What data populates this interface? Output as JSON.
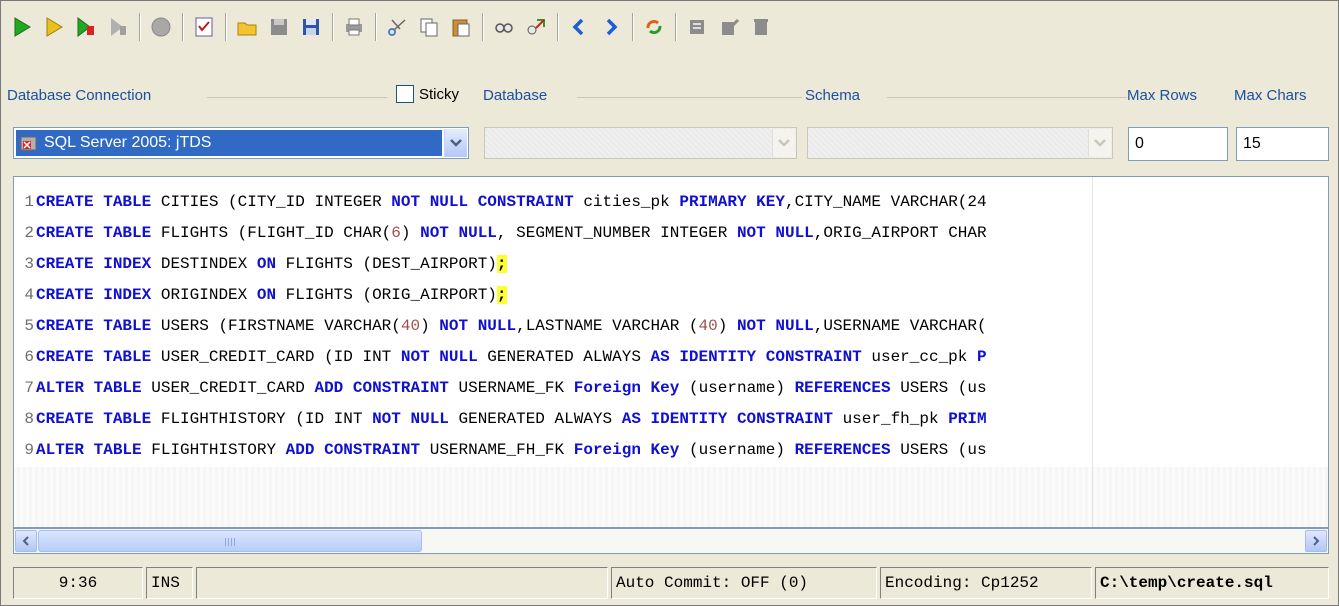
{
  "toolbar": {
    "buttons": [
      {
        "name": "execute-icon",
        "color": "#22a822"
      },
      {
        "name": "execute-current-icon",
        "color": "#d0a000"
      },
      {
        "name": "execute-all-icon",
        "color": "#22a822"
      },
      {
        "name": "stop-all-icon",
        "color": "#9c9c9c"
      },
      {
        "name": "stop-icon",
        "color": "#9c9c9c"
      },
      {
        "name": "commit-icon",
        "color": "#7c4fa8"
      },
      {
        "name": "open-folder-icon",
        "color": "#e8b018"
      },
      {
        "name": "save-disabled-icon",
        "color": "#8c8c8c"
      },
      {
        "name": "save-as-icon",
        "color": "#2f55a8"
      },
      {
        "name": "print-icon",
        "color": "#6c6c6c"
      },
      {
        "name": "cut-icon",
        "color": "#4f7fd0"
      },
      {
        "name": "copy-icon",
        "color": "#6c6c6c"
      },
      {
        "name": "paste-icon",
        "color": "#c89038"
      },
      {
        "name": "find-icon",
        "color": "#6c6c6c"
      },
      {
        "name": "replace-icon",
        "color": "#3a9a3a"
      },
      {
        "name": "previous-icon",
        "color": "#1c5ed8"
      },
      {
        "name": "next-icon",
        "color": "#1c5ed8"
      },
      {
        "name": "refresh-icon",
        "color": "#e06010"
      },
      {
        "name": "history-icon",
        "color": "#8c8c8c"
      },
      {
        "name": "edit-disabled-icon",
        "color": "#8c8c8c"
      },
      {
        "name": "delete-disabled-icon",
        "color": "#8c8c8c"
      }
    ]
  },
  "connection": {
    "db_connection_label": "Database Connection",
    "sticky_label": "Sticky",
    "database_label": "Database",
    "schema_label": "Schema",
    "max_rows_label": "Max Rows",
    "max_chars_label": "Max Chars",
    "db_connection_value": "SQL Server 2005: jTDS",
    "max_rows_value": "0",
    "max_chars_value": "15"
  },
  "editor": {
    "lines": [
      {
        "n": "1",
        "tokens": [
          [
            "kw",
            "CREATE"
          ],
          [
            "t",
            " "
          ],
          [
            "kw",
            "TABLE"
          ],
          [
            "t",
            " CITIES (CITY_ID INTEGER "
          ],
          [
            "kw",
            "NOT NULL"
          ],
          [
            "t",
            " "
          ],
          [
            "kw",
            "CONSTRAINT"
          ],
          [
            "t",
            " cities_pk "
          ],
          [
            "kw",
            "PRIMARY KEY"
          ],
          [
            "t",
            ",CITY_NAME VARCHAR(24"
          ]
        ]
      },
      {
        "n": "2",
        "tokens": [
          [
            "kw",
            "CREATE"
          ],
          [
            "t",
            " "
          ],
          [
            "kw",
            "TABLE"
          ],
          [
            "t",
            " FLIGHTS (FLIGHT_ID CHAR("
          ],
          [
            "num",
            "6"
          ],
          [
            "t",
            ") "
          ],
          [
            "kw",
            "NOT NULL"
          ],
          [
            "t",
            ", SEGMENT_NUMBER INTEGER "
          ],
          [
            "kw",
            "NOT NULL"
          ],
          [
            "t",
            ",ORIG_AIRPORT CHAR"
          ]
        ]
      },
      {
        "n": "3",
        "tokens": [
          [
            "kw",
            "CREATE"
          ],
          [
            "t",
            " "
          ],
          [
            "kw",
            "INDEX"
          ],
          [
            "t",
            " DESTINDEX "
          ],
          [
            "kw",
            "ON"
          ],
          [
            "t",
            " FLIGHTS (DEST_AIRPORT)"
          ],
          [
            "hl",
            ";"
          ]
        ]
      },
      {
        "n": "4",
        "tokens": [
          [
            "kw",
            "CREATE"
          ],
          [
            "t",
            " "
          ],
          [
            "kw",
            "INDEX"
          ],
          [
            "t",
            " ORIGINDEX "
          ],
          [
            "kw",
            "ON"
          ],
          [
            "t",
            " FLIGHTS (ORIG_AIRPORT)"
          ],
          [
            "hl",
            ";"
          ]
        ]
      },
      {
        "n": "5",
        "tokens": [
          [
            "kw",
            "CREATE"
          ],
          [
            "t",
            " "
          ],
          [
            "kw",
            "TABLE"
          ],
          [
            "t",
            " USERS (FIRSTNAME VARCHAR("
          ],
          [
            "num",
            "40"
          ],
          [
            "t",
            ") "
          ],
          [
            "kw",
            "NOT NULL"
          ],
          [
            "t",
            ",LASTNAME VARCHAR ("
          ],
          [
            "num",
            "40"
          ],
          [
            "t",
            ") "
          ],
          [
            "kw",
            "NOT NULL"
          ],
          [
            "t",
            ",USERNAME VARCHAR("
          ]
        ]
      },
      {
        "n": "6",
        "tokens": [
          [
            "kw",
            "CREATE"
          ],
          [
            "t",
            " "
          ],
          [
            "kw",
            "TABLE"
          ],
          [
            "t",
            " USER_CREDIT_CARD (ID INT "
          ],
          [
            "kw",
            "NOT NULL"
          ],
          [
            "t",
            " GENERATED ALWAYS "
          ],
          [
            "kw",
            "AS"
          ],
          [
            "t",
            " "
          ],
          [
            "kw",
            "IDENTITY"
          ],
          [
            "t",
            " "
          ],
          [
            "kw",
            "CONSTRAINT"
          ],
          [
            "t",
            " user_cc_pk "
          ],
          [
            "kw",
            "P"
          ]
        ]
      },
      {
        "n": "7",
        "tokens": [
          [
            "kw",
            "ALTER"
          ],
          [
            "t",
            " "
          ],
          [
            "kw",
            "TABLE"
          ],
          [
            "t",
            " USER_CREDIT_CARD "
          ],
          [
            "kw",
            "ADD"
          ],
          [
            "t",
            " "
          ],
          [
            "kw",
            "CONSTRAINT"
          ],
          [
            "t",
            " USERNAME_FK "
          ],
          [
            "kw",
            "Foreign Key"
          ],
          [
            "t",
            " (username) "
          ],
          [
            "kw",
            "REFERENCES"
          ],
          [
            "t",
            " USERS (us"
          ]
        ]
      },
      {
        "n": "8",
        "tokens": [
          [
            "kw",
            "CREATE"
          ],
          [
            "t",
            " "
          ],
          [
            "kw",
            "TABLE"
          ],
          [
            "t",
            " FLIGHTHISTORY (ID INT "
          ],
          [
            "kw",
            "NOT NULL"
          ],
          [
            "t",
            " GENERATED ALWAYS "
          ],
          [
            "kw",
            "AS"
          ],
          [
            "t",
            " "
          ],
          [
            "kw",
            "IDENTITY"
          ],
          [
            "t",
            " "
          ],
          [
            "kw",
            "CONSTRAINT"
          ],
          [
            "t",
            " user_fh_pk "
          ],
          [
            "kw",
            "PRIM"
          ]
        ]
      },
      {
        "n": "9",
        "tokens": [
          [
            "kw",
            "ALTER"
          ],
          [
            "t",
            " "
          ],
          [
            "kw",
            "TABLE"
          ],
          [
            "t",
            " FLIGHTHISTORY "
          ],
          [
            "kw",
            "ADD"
          ],
          [
            "t",
            " "
          ],
          [
            "kw",
            "CONSTRAINT"
          ],
          [
            "t",
            " USERNAME_FH_FK "
          ],
          [
            "kw",
            "Foreign Key"
          ],
          [
            "t",
            " (username) "
          ],
          [
            "kw",
            "REFERENCES"
          ],
          [
            "t",
            " USERS (us"
          ]
        ]
      }
    ]
  },
  "status": {
    "position": "9:36",
    "mode": "INS",
    "auto_commit": "Auto Commit: OFF (0)",
    "encoding": "Encoding: Cp1252",
    "file_path": "C:\\temp\\create.sql"
  }
}
